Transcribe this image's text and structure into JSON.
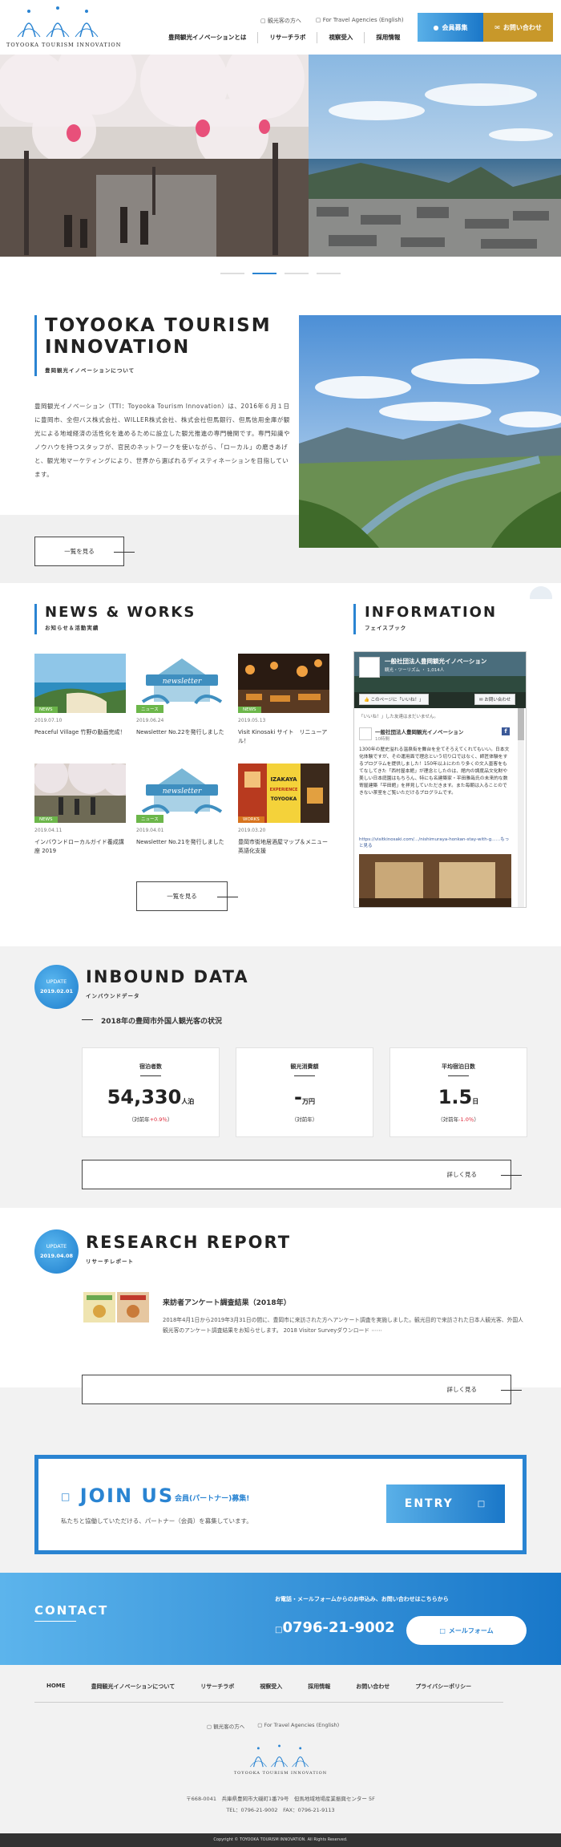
{
  "header": {
    "logo_text": "TOYOOKA TOURISM INNOVATION",
    "toplinks": [
      "観光客の方へ",
      "For Travel Agencies (English)"
    ],
    "nav": [
      "豊岡観光イノベーションとは",
      "リサーチラボ",
      "視察受入",
      "採用情報"
    ],
    "member_button": "会員募集",
    "contact_button": "お問い合わせ"
  },
  "about": {
    "title_line1": "TOYOOKA TOURISM",
    "title_line2": "INNOVATION",
    "subtitle": "豊岡観光イノベーションについて",
    "body": "豊岡観光イノベーション（TTI：Toyooka Tourism Innovation）は、2016年６月１日に豊岡市、全但バス株式会社、WILLER株式会社、株式会社但馬銀行、但馬信用金庫が観光による地域経済の活性化を進めるために設立した観光推進の専門機関です。専門知識やノウハウを持つスタッフが、官民のネットワークを使いながら、「ローカル」の磨きあげと、観光地マーケティングにより、世界から選ばれるディスティネーションを目指しています。",
    "more": "一覧を見る"
  },
  "news": {
    "title": "NEWS & WORKS",
    "subtitle": "お知らせ＆活動実績",
    "items": [
      {
        "tag": "NEWS",
        "date": "2019.07.10",
        "title": "Peaceful Village 竹野の動画完成！"
      },
      {
        "tag": "ニュース",
        "date": "2019.06.24",
        "title": "Newsletter No.22を発行しました"
      },
      {
        "tag": "NEWS",
        "date": "2019.05.13",
        "title": "Visit Kinosaki サイト　リニューアル！"
      },
      {
        "tag": "NEWS",
        "date": "2019.04.11",
        "title": "インバウンドローカルガイド養成講座 2019"
      },
      {
        "tag": "ニュース",
        "date": "2019.04.01",
        "title": "Newsletter No.21を発行しました"
      },
      {
        "tag": "WORKS",
        "date": "2019.03.20",
        "title": "豊岡市街地居酒屋マップ＆メニュー英語化支援"
      }
    ],
    "newsletter_word": "newsletter",
    "izakaya_text": "IZAKAYA EXPERIENCE TOYOOKA",
    "more": "一覧を見る"
  },
  "info": {
    "title": "INFORMATION",
    "subtitle": "フェイスブック",
    "fb_page": "一般社団法人豊岡観光イノベーション",
    "fb_likes": "観光・ツーリズム ・ 1,014人",
    "fb_like_btn": "このページに「いいね！」",
    "fb_msg_btn": "お問い合わせ",
    "fb_notice": "「いいね！」した友達はまだいません。",
    "post_name": "一般社団法人豊岡観光イノベーション",
    "post_date": "10時間",
    "post_text": "1300年の歴史溢れる温泉街を舞台を全てそろえてくれてもいい。日本文化体験ですが、その運用面で理念という切り口ではなく、師匠体験をするプログラムを提供しました！150年以上にわたり多くの文人墨客をもてなしてきた「西村屋本館」が理念としたのは、館内の調度品文化財や美しい日本庭園はもちろん、特にも名建築家・平田雅哉氏の未来的な数寄屋建築「平田館」を拝見していただきます。また毎朝は入ることのできない茶室をご覧いただけるプログラムです。",
    "post_link": "https://visitkinosaki.com/…/nishimuraya-honkan-stay-with-g…",
    "post_more": "…もっと見る"
  },
  "inbound": {
    "badge_top": "UPDATE",
    "badge_date": "2019.02.01",
    "title": "INBOUND DATA",
    "subtitle": "インバウンドデータ",
    "heading": "2018年の豊岡市外国人観光客の状況",
    "cards": [
      {
        "label": "宿泊者数",
        "value": "54,330",
        "unit": "人泊",
        "cmp_label": "（対前年",
        "cmp_value": "+0.9％",
        "cmp_end": "）"
      },
      {
        "label": "観光消費額",
        "value": "-",
        "unit": "万円",
        "cmp_label": "（対前年）",
        "cmp_value": "",
        "cmp_end": ""
      },
      {
        "label": "平均宿泊日数",
        "value": "1.5",
        "unit": "日",
        "cmp_label": "（対前年",
        "cmp_value": "-1.0％",
        "cmp_end": "）"
      }
    ],
    "more": "詳しく見る"
  },
  "research": {
    "badge_top": "UPDATE",
    "badge_date": "2019.04.08",
    "title": "RESEARCH REPORT",
    "subtitle": "リサーチレポート",
    "item_title": "来訪者アンケート調査結果（2018年）",
    "item_text": "2018年4月1日から2019年3月31日の間に、豊岡市に来訪された方へアンケート調査を実施しました。観光目的で来訪された日本人観光客、外国人観光客のアンケート調査結果をお知らせします。 2018 Visitor Surveyダウンロード ⋯⋯",
    "more": "詳しく見る"
  },
  "join": {
    "title": "JOIN US",
    "subtitle": "会員(パートナー)募集!",
    "text": "私たちと協働していただける、パートナー（会員）を募集しています。",
    "button": "ENTRY"
  },
  "contact": {
    "title": "CONTACT",
    "lead": "お電話・メールフォームからのお申込み、お問い合わせはこちらから",
    "phone": "0796-21-9002",
    "form_button": "メールフォーム"
  },
  "footer": {
    "nav": [
      "HOME",
      "豊岡観光イノベーションについて",
      "リサーチラボ",
      "視察受入",
      "採用情報",
      "お問い合わせ",
      "プライバシーポリシー"
    ],
    "sublinks": [
      "観光客の方へ",
      "For Travel Agencies (English)"
    ],
    "logo_text": "TOYOOKA TOURISM INNOVATION",
    "address": "〒668-0041　兵庫県豊岡市大磯町1番79号　但馬地域地場産業振興センター 5F",
    "tel": "TEL：0796-21-9002　FAX：0796-21-9113",
    "copyright": "Copyright © TOYOOKA TOURISM INNOVATION. All Rights Reserved."
  },
  "colors": {
    "accent": "#2a84d2",
    "gold": "#c8982a",
    "green": "#6cb64a",
    "grey_bg": "#f2f2f2"
  }
}
